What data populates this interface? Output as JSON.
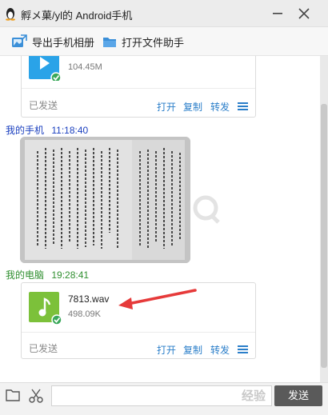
{
  "window": {
    "title": "孵メ菓/yl的 Android手机"
  },
  "toolbar": {
    "export_label": "导出手机相册",
    "open_folder_label": "打开文件助手"
  },
  "messages": {
    "file1": {
      "size": "104.45M",
      "status": "已发送",
      "open": "打开",
      "copy": "复制",
      "forward": "转发"
    },
    "sender1": {
      "name": "我的手机",
      "time": "11:18:40"
    },
    "sender2": {
      "name": "我的电脑",
      "time": "19:28:41"
    },
    "file2": {
      "name": "7813.wav",
      "size": "498.09K",
      "status": "已发送",
      "open": "打开",
      "copy": "复制",
      "forward": "转发"
    }
  },
  "bottom": {
    "send_label": "发送",
    "watermark_text": "经验"
  },
  "colors": {
    "link": "#2a7ec9",
    "sender_phone": "#1a3fbf",
    "sender_pc": "#2f8f2f",
    "video_icon": "#2aa3e8",
    "audio_icon": "#7cc13a",
    "annotation_arrow": "#e63a3a"
  }
}
